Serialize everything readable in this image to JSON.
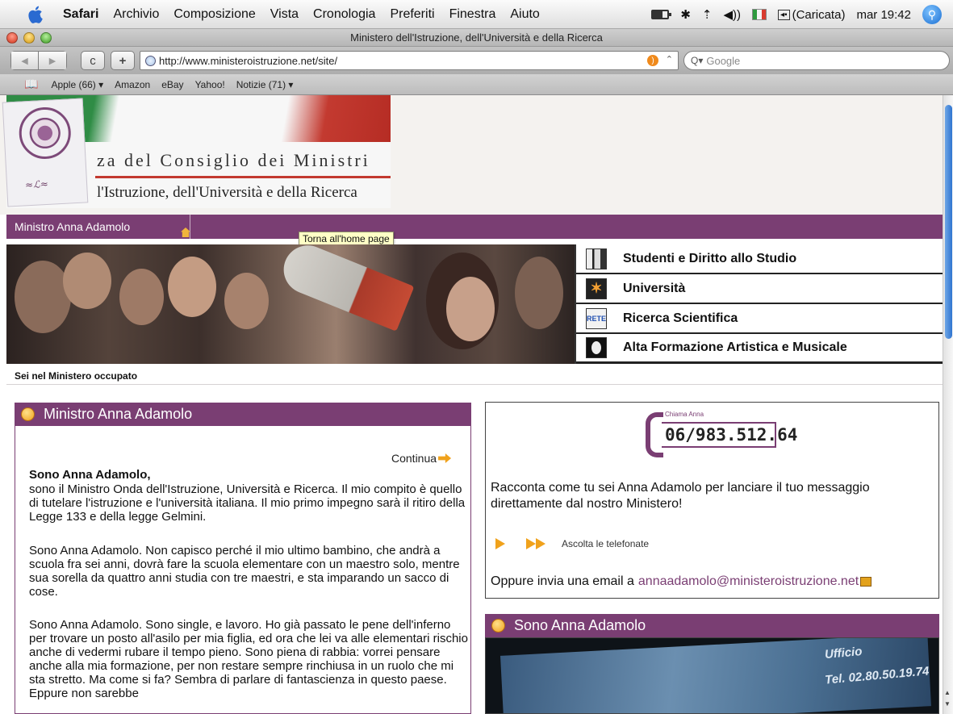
{
  "menubar": {
    "app": "Safari",
    "items": [
      "Archivio",
      "Composizione",
      "Vista",
      "Cronologia",
      "Preferiti",
      "Finestra",
      "Aiuto"
    ],
    "battery_status": "(Caricata)",
    "clock": "mar 19:42"
  },
  "window": {
    "title": "Ministero dell'Istruzione, dell'Università e della Ricerca"
  },
  "toolbar": {
    "back": "◀",
    "forward": "▶",
    "reload": "c",
    "add": "+",
    "url": "http://www.ministeroistruzione.net/site/",
    "search_placeholder": "Google"
  },
  "bookmarks": [
    "Apple (66) ▾",
    "Amazon",
    "eBay",
    "Yahoo!",
    "Notizie (71) ▾"
  ],
  "header": {
    "line1": "za del Consiglio dei Ministri",
    "line2": "l'Istruzione, dell'Università e della Ricerca"
  },
  "nav": {
    "brand": "Ministro Anna Adamolo",
    "tooltip": "Torna all'home page"
  },
  "sections": [
    {
      "label": "Studenti e Diritto allo Studio",
      "icon": "students-icon"
    },
    {
      "label": "Università",
      "icon": "university-icon"
    },
    {
      "label": "Ricerca Scientifica",
      "icon": "rete-icon",
      "icon_text": "RETE"
    },
    {
      "label": "Alta Formazione Artistica e Musicale",
      "icon": "mask-icon"
    }
  ],
  "breadcrumb": "Sei nel Ministero occupato",
  "left_panel": {
    "title": "Ministro Anna Adamolo",
    "continue": "Continua",
    "lead": "Sono Anna Adamolo,",
    "para1": "sono il Ministro Onda dell'Istruzione, Università e Ricerca. Il mio compito è quello di tutelare l'istruzione e l'università italiana. Il mio primo impegno sarà il ritiro della Legge 133 e della legge Gelmini.",
    "para2": "Sono Anna Adamolo. Non capisco perché il mio ultimo bambino, che andrà a scuola fra sei anni, dovrà fare la scuola elementare con un maestro solo, mentre sua sorella da quattro anni studia con tre maestri, e sta imparando un sacco di cose.",
    "para3": "Sono Anna Adamolo. Sono single, e lavoro. Ho già passato le pene dell'inferno per trovare un posto all'asilo per mia figlia, ed ora che lei va alle elementari rischio anche di vedermi rubare il tempo pieno. Sono piena di rabbia: vorrei pensare anche alla mia formazione, per non restare sempre rinchiusa in un ruolo che mi sta stretto. Ma come si fa? Sembra di parlare di fantascienza in questo paese. Eppure non sarebbe"
  },
  "right_panel": {
    "phone_caption": "Chiama Anna",
    "phone_number": "06/983.512.64",
    "text": "Racconta come tu sei Anna Adamolo per lanciare il tuo messaggio direttamente dal nostro Ministero!",
    "listen": "Ascolta le telefonate",
    "email_prefix": "Oppure invia una email a",
    "email": "annaadamolo@ministeroistruzione.net"
  },
  "video_panel": {
    "title": "Sono Anna Adamolo",
    "sign_office": "Ufficio",
    "sign_tel": "Tel. 02.80.50.19.74"
  },
  "colors": {
    "accent": "#7a3e73",
    "orange": "#f0a21c"
  }
}
